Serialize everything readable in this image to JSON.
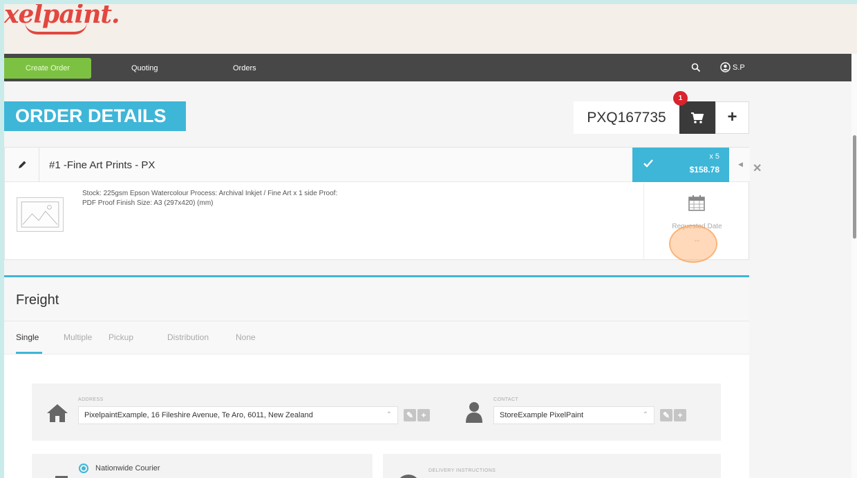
{
  "brand": {
    "logo_text": "xelpaint.",
    "accent": "#e2473f"
  },
  "nav": {
    "create_order": "Create Order",
    "quoting": "Quoting",
    "orders": "Orders",
    "user_initials": "S.P"
  },
  "page": {
    "title": "ORDER DETAILS",
    "order_number": "PXQ167735",
    "cart_count": "1"
  },
  "item": {
    "title": "#1 -Fine Art Prints - PX",
    "qty": "x 5",
    "price": "$158.78",
    "description": "Stock: 225gsm Epson Watercolour Process: Archival Inkjet / Fine Art x 1 side Proof: PDF Proof Finish Size: A3 (297x420) (mm)",
    "requested_date_label": "Requested Date",
    "requested_date_value": "--"
  },
  "freight": {
    "title": "Freight",
    "tabs": [
      "Single",
      "Multiple",
      "Pickup",
      "Distribution",
      "None"
    ],
    "address_label": "ADDRESS",
    "address_value": "PixelpaintExample, 16 Fileshire Avenue, Te Aro, 6011, New Zealand",
    "contact_label": "CONTACT",
    "contact_value": "StoreExample PixelPaint",
    "courier_label": "Nationwide Courier",
    "delivery_label": "DELIVERY INSTRUCTIONS"
  },
  "colors": {
    "blue": "#3eb6d8",
    "green": "#7dc142",
    "nav": "#474747",
    "badge": "#d9232d"
  }
}
